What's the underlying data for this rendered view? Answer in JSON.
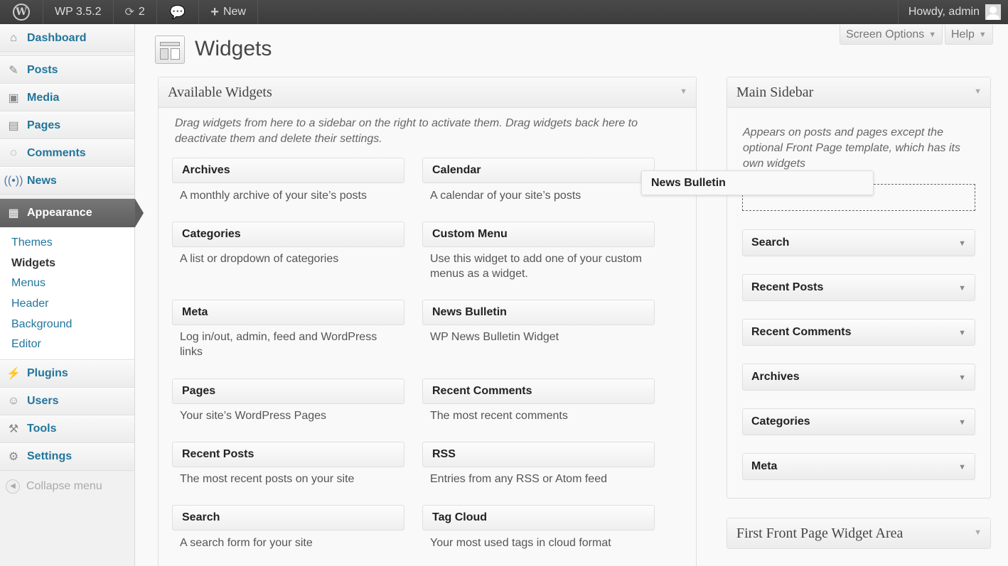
{
  "adminbar": {
    "version": "WP 3.5.2",
    "updates": "2",
    "new_label": "New",
    "howdy": "Howdy, admin"
  },
  "menu": {
    "dashboard": "Dashboard",
    "posts": "Posts",
    "media": "Media",
    "pages": "Pages",
    "comments": "Comments",
    "news": "News",
    "appearance": "Appearance",
    "sub": [
      "Themes",
      "Widgets",
      "Menus",
      "Header",
      "Background",
      "Editor"
    ],
    "plugins": "Plugins",
    "users": "Users",
    "tools": "Tools",
    "settings": "Settings",
    "collapse": "Collapse menu"
  },
  "page": {
    "title": "Widgets",
    "screen_options": "Screen Options",
    "help": "Help"
  },
  "available": {
    "title": "Available Widgets",
    "description": "Drag widgets from here to a sidebar on the right to activate them. Drag widgets back here to deactivate them and delete their settings.",
    "widgets": [
      {
        "title": "Archives",
        "desc": "A monthly archive of your site’s posts"
      },
      {
        "title": "Calendar",
        "desc": "A calendar of your site’s posts"
      },
      {
        "title": "Categories",
        "desc": "A list or dropdown of categories"
      },
      {
        "title": "Custom Menu",
        "desc": "Use this widget to add one of your custom menus as a widget."
      },
      {
        "title": "Meta",
        "desc": "Log in/out, admin, feed and WordPress links"
      },
      {
        "title": "News Bulletin",
        "desc": "WP News Bulletin Widget"
      },
      {
        "title": "Pages",
        "desc": "Your site’s WordPress Pages"
      },
      {
        "title": "Recent Comments",
        "desc": "The most recent comments"
      },
      {
        "title": "Recent Posts",
        "desc": "The most recent posts on your site"
      },
      {
        "title": "RSS",
        "desc": "Entries from any RSS or Atom feed"
      },
      {
        "title": "Search",
        "desc": "A search form for your site"
      },
      {
        "title": "Tag Cloud",
        "desc": "Your most used tags in cloud format"
      }
    ]
  },
  "main_sidebar": {
    "title": "Main Sidebar",
    "description": "Appears on posts and pages except the optional Front Page template, which has its own widgets",
    "widgets": [
      "Search",
      "Recent Posts",
      "Recent Comments",
      "Archives",
      "Categories",
      "Meta"
    ]
  },
  "dragging_widget": "News Bulletin",
  "front_area": {
    "title": "First Front Page Widget Area"
  }
}
